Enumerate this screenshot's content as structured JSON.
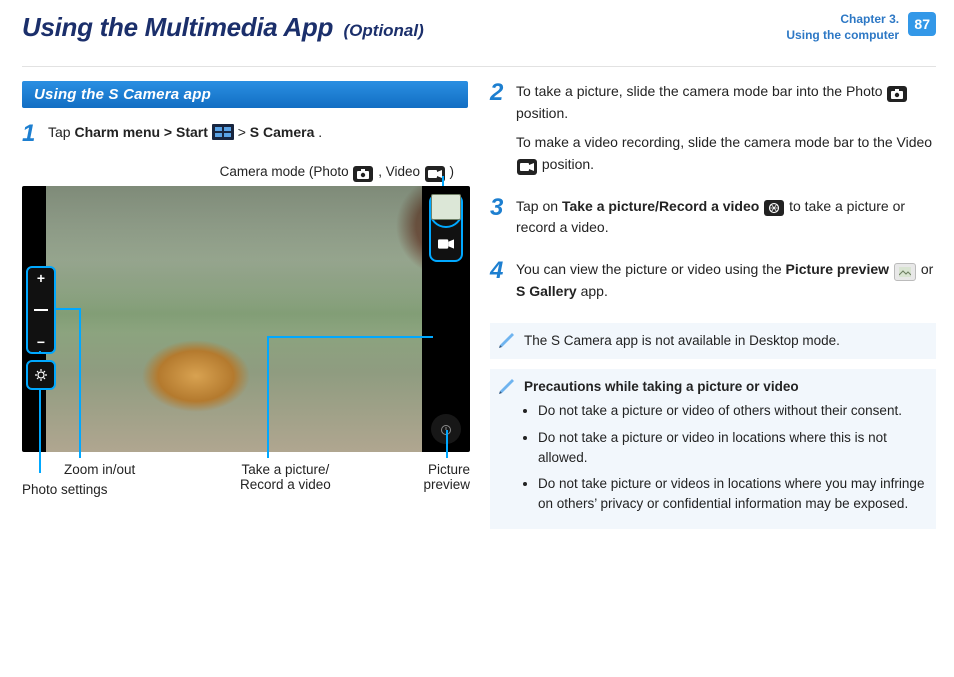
{
  "header": {
    "title": "Using the Multimedia App",
    "suffix": "(Optional)",
    "chapter_line1": "Chapter 3.",
    "chapter_line2": "Using the computer",
    "page_number": "87"
  },
  "left": {
    "section_title": "Using the S Camera app",
    "step1": {
      "t1": "Tap ",
      "b1": "Charm menu > Start",
      "t2": " > ",
      "b2": "S Camera",
      "t3": "."
    },
    "mode_label": {
      "pre": "Camera mode (Photo ",
      "mid": ", Video ",
      "post": ")"
    },
    "captions": {
      "zoom": "Zoom in/out",
      "photo_settings": "Photo settings",
      "take": "Take a picture/\nRecord a video",
      "preview": "Picture\npreview"
    }
  },
  "right": {
    "step2": {
      "p1a": "To take a picture, slide the camera mode bar into the Photo ",
      "p1b": " position.",
      "p2a": "To make a video recording, slide the camera mode bar to the Video ",
      "p2b": " position."
    },
    "step3": {
      "a": "Tap on ",
      "b": "Take a picture/Record a video",
      "c": " to take a picture or record a video."
    },
    "step4": {
      "a": "You can view the picture or video using the ",
      "b": "Picture preview",
      "c": " or ",
      "d": "S Gallery",
      "e": " app."
    },
    "note1": "The S Camera app is not available in Desktop mode.",
    "note2": {
      "title": "Precautions while taking a picture or video",
      "items": [
        "Do not take a picture or video of others without their consent.",
        "Do not take a picture or video in locations where this is not allowed.",
        "Do not take picture or videos in locations where you may infringe on others’ privacy or confidential information may be exposed."
      ]
    }
  }
}
